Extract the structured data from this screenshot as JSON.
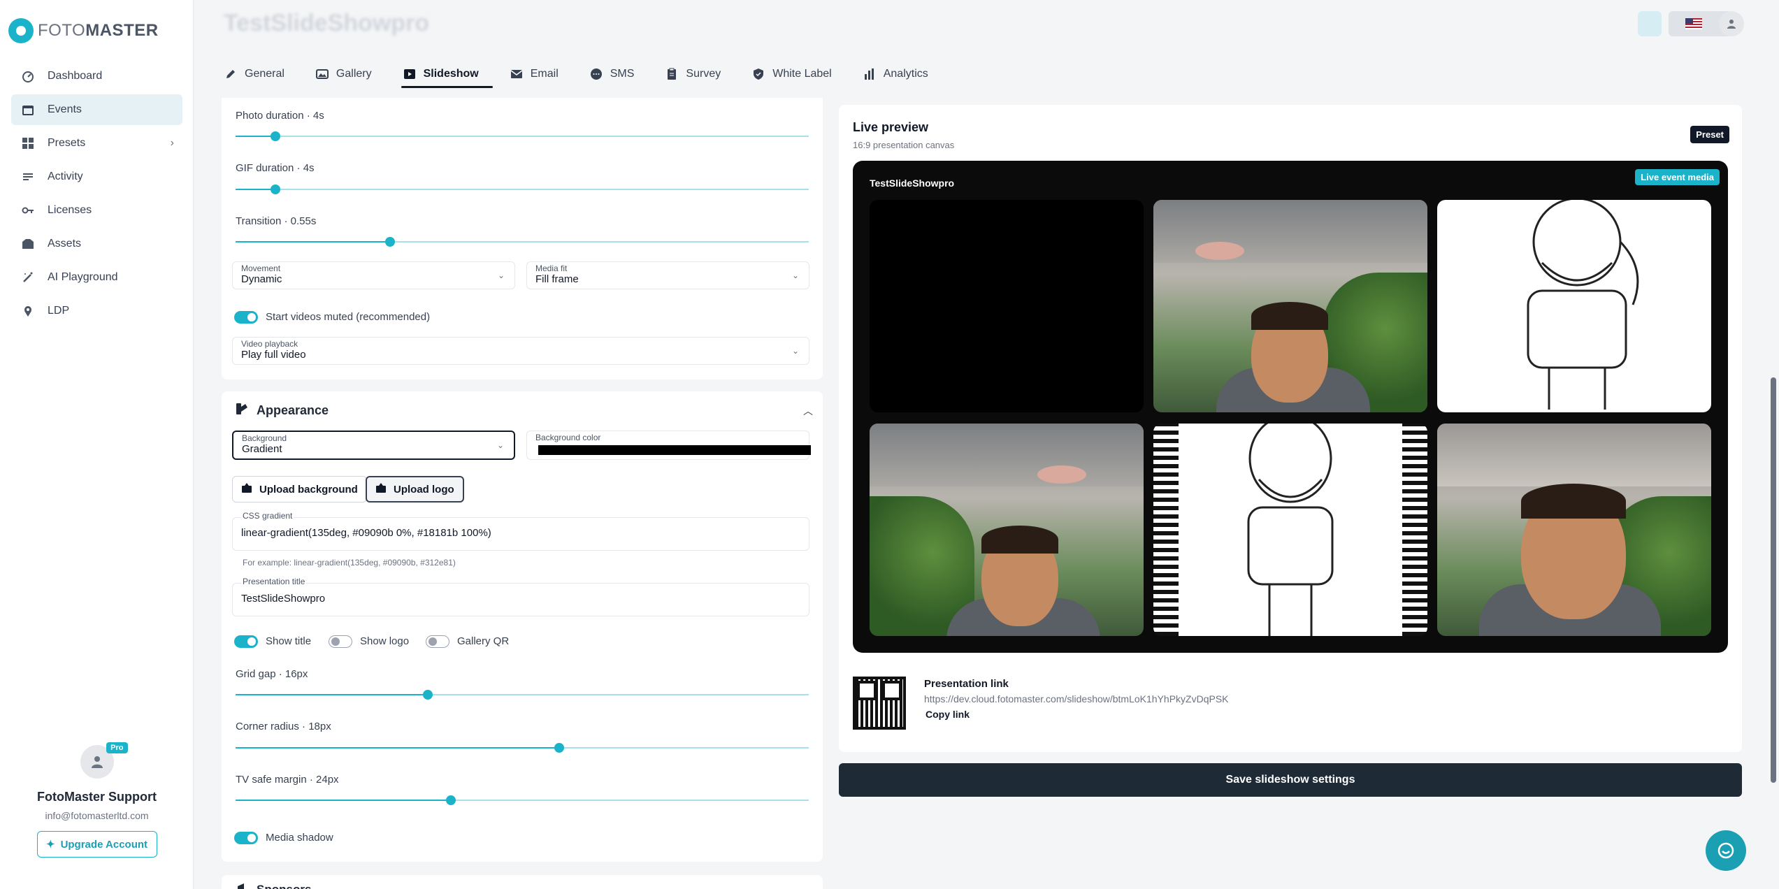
{
  "brand": {
    "name_light": "FOTO",
    "name_bold": "MASTER",
    "accent": "#1ab3c9"
  },
  "sidebar": {
    "items": [
      {
        "label": "Dashboard",
        "icon": "dashboard-icon"
      },
      {
        "label": "Events",
        "icon": "calendar-icon",
        "active": true
      },
      {
        "label": "Presets",
        "icon": "grid-icon",
        "has_chevron": true
      },
      {
        "label": "Activity",
        "icon": "activity-icon"
      },
      {
        "label": "Licenses",
        "icon": "key-icon"
      },
      {
        "label": "Assets",
        "icon": "folder-icon"
      },
      {
        "label": "AI Playground",
        "icon": "magic-wand-icon"
      },
      {
        "label": "LDP",
        "icon": "location-icon"
      }
    ],
    "profile": {
      "badge": "Pro",
      "name": "FotoMaster Support",
      "email": "info@fotomasterltd.com",
      "upgrade_label": "Upgrade Account"
    }
  },
  "header": {
    "title": "TestSlideShowpro"
  },
  "tabs": [
    {
      "label": "General",
      "icon": "pencil-icon"
    },
    {
      "label": "Gallery",
      "icon": "image-icon"
    },
    {
      "label": "Slideshow",
      "icon": "slideshow-icon",
      "active": true
    },
    {
      "label": "Email",
      "icon": "mail-icon"
    },
    {
      "label": "SMS",
      "icon": "chat-icon"
    },
    {
      "label": "Survey",
      "icon": "clipboard-icon"
    },
    {
      "label": "White Label",
      "icon": "shield-icon"
    },
    {
      "label": "Analytics",
      "icon": "bar-chart-icon"
    }
  ],
  "playback": {
    "photo_duration": {
      "label": "Photo duration · 4s",
      "fraction": 0.07
    },
    "gif_duration": {
      "label": "GIF duration · 4s",
      "fraction": 0.07
    },
    "transition": {
      "label": "Transition · 0.55s",
      "fraction": 0.27
    },
    "movement": {
      "label": "Movement",
      "value": "Dynamic"
    },
    "media_fit": {
      "label": "Media fit",
      "value": "Fill frame"
    },
    "start_muted": {
      "label": "Start videos muted (recommended)",
      "on": true
    },
    "video_playback": {
      "label": "Video playback",
      "value": "Play full video"
    }
  },
  "appearance": {
    "title": "Appearance",
    "background": {
      "label": "Background",
      "value": "Gradient"
    },
    "background_color": {
      "label": "Background color",
      "value": "#000000"
    },
    "upload_background": "Upload background",
    "upload_logo": "Upload logo",
    "css_gradient": {
      "label": "CSS gradient",
      "value": "linear-gradient(135deg, #09090b 0%, #18181b 100%)"
    },
    "css_hint": "For example: linear-gradient(135deg, #09090b, #312e81)",
    "presentation_title": {
      "label": "Presentation title",
      "value": "TestSlideShowpro"
    },
    "show_title": {
      "label": "Show title",
      "on": true
    },
    "show_logo": {
      "label": "Show logo",
      "on": false
    },
    "gallery_qr": {
      "label": "Gallery QR",
      "on": false
    },
    "grid_gap": {
      "label": "Grid gap · 16px",
      "fraction": 0.335
    },
    "corner_radius": {
      "label": "Corner radius · 18px",
      "fraction": 0.565
    },
    "tv_safe_margin": {
      "label": "TV safe margin · 24px",
      "fraction": 0.375
    },
    "media_shadow": {
      "label": "Media shadow",
      "on": true
    },
    "next_section": "Sponsors"
  },
  "preview": {
    "title": "Live preview",
    "subtitle": "16:9 presentation canvas",
    "badge": "Preset",
    "canvas_title": "TestSlideShowpro",
    "live_badge": "Live event media",
    "link_label": "Presentation link",
    "link_url": "https://dev.cloud.fotomaster.com/slideshow/btmLoK1hYhPkyZvDqPSK",
    "copy_label": "Copy link"
  },
  "save_label": "Save slideshow settings"
}
